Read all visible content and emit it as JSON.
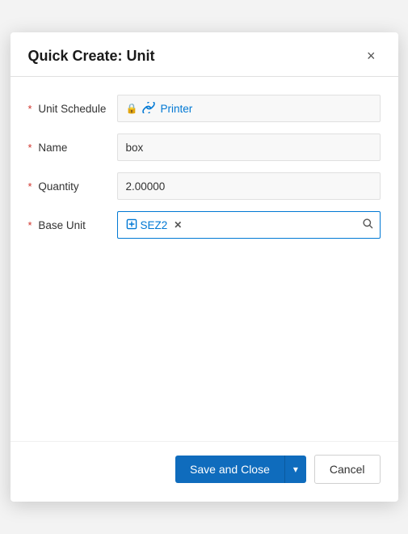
{
  "dialog": {
    "title": "Quick Create: Unit",
    "close_label": "×"
  },
  "form": {
    "unit_schedule": {
      "label": "Unit Schedule",
      "value": "Printer",
      "icon": "link-icon"
    },
    "name": {
      "label": "Name",
      "value": "box"
    },
    "quantity": {
      "label": "Quantity",
      "value": "2.00000"
    },
    "base_unit": {
      "label": "Base Unit",
      "tag": "SEZ2"
    }
  },
  "footer": {
    "save_close_label": "Save and Close",
    "cancel_label": "Cancel",
    "dropdown_icon": "▾"
  }
}
